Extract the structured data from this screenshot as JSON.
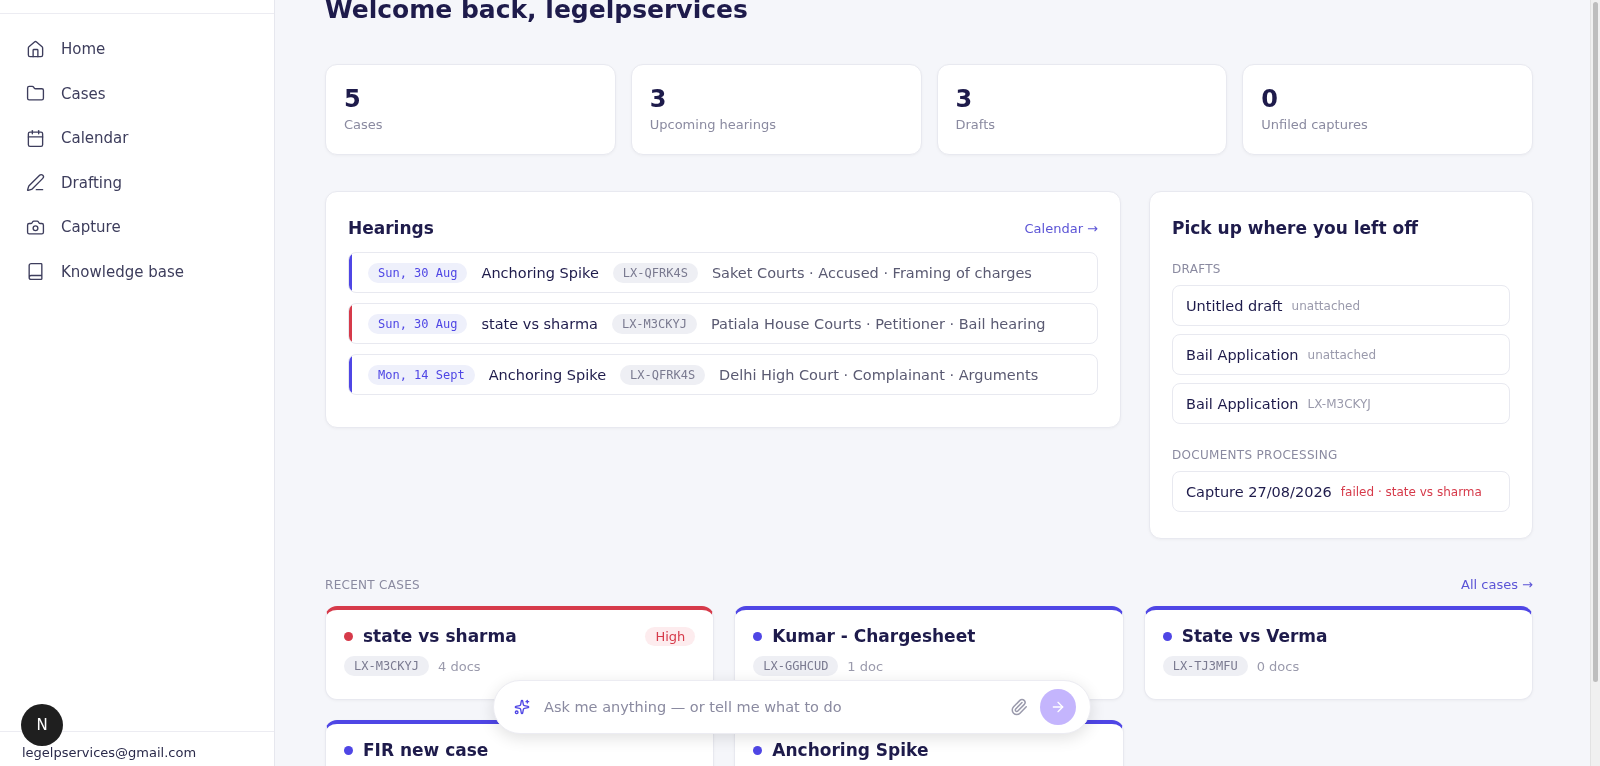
{
  "sidebar": {
    "items": [
      {
        "label": "Home",
        "selected": false
      },
      {
        "label": "Cases",
        "selected": false
      },
      {
        "label": "Calendar",
        "selected": false
      },
      {
        "label": "Drafting",
        "selected": false
      },
      {
        "label": "Capture",
        "selected": false
      },
      {
        "label": "Knowledge base",
        "selected": false
      }
    ],
    "avatar": "N",
    "email": "legelpservices@gmail.com"
  },
  "heading": "Welcome back, legelpservices",
  "stats": [
    {
      "value": "5",
      "label": "Cases"
    },
    {
      "value": "3",
      "label": "Upcoming hearings"
    },
    {
      "value": "3",
      "label": "Drafts"
    },
    {
      "value": "0",
      "label": "Unfiled captures"
    }
  ],
  "hearings": {
    "title": "Hearings",
    "link": "Calendar →",
    "rows": [
      {
        "date": "Sun, 30 Aug",
        "case": "Anchoring Spike",
        "code": "LX-QFRK4S",
        "details": "Saket Courts · Accused · Framing of charges",
        "color": "#4f46e5"
      },
      {
        "date": "Sun, 30 Aug",
        "case": "state vs sharma",
        "code": "LX-M3CKYJ",
        "details": "Patiala House Courts · Petitioner · Bail hearing",
        "color": "#d63a4a"
      },
      {
        "date": "Mon, 14 Sept",
        "case": "Anchoring Spike",
        "code": "LX-QFRK4S",
        "details": "Delhi High Court · Complainant · Arguments",
        "color": "#4f46e5"
      }
    ]
  },
  "pickup": {
    "title": "Pick up where you left off",
    "drafts_label": "DRAFTS",
    "drafts": [
      {
        "title": "Untitled draft",
        "meta": "unattached"
      },
      {
        "title": "Bail Application",
        "meta": "unattached"
      },
      {
        "title": "Bail Application",
        "meta": "LX-M3CKYJ"
      }
    ],
    "processing_label": "DOCUMENTS PROCESSING",
    "processing": [
      {
        "title": "Capture 27/08/2026",
        "meta": "failed · state vs sharma"
      }
    ]
  },
  "recent": {
    "label": "RECENT CASES",
    "link": "All cases →",
    "cases": [
      {
        "name": "state vs sharma",
        "code": "LX-M3CKYJ",
        "docs": "4 docs",
        "priority": "High",
        "color": "#d63a4a"
      },
      {
        "name": "Kumar - Chargesheet",
        "code": "LX-GGHCUD",
        "docs": "1 doc",
        "color": "#4f46e5"
      },
      {
        "name": "State vs Verma",
        "code": "LX-TJ3MFU",
        "docs": "0 docs",
        "color": "#4f46e5"
      },
      {
        "name": "FIR new case",
        "color": "#4f46e5"
      },
      {
        "name": "Anchoring Spike",
        "color": "#4f46e5"
      }
    ]
  },
  "assistant": {
    "placeholder": "Ask me anything — or tell me what to do"
  }
}
